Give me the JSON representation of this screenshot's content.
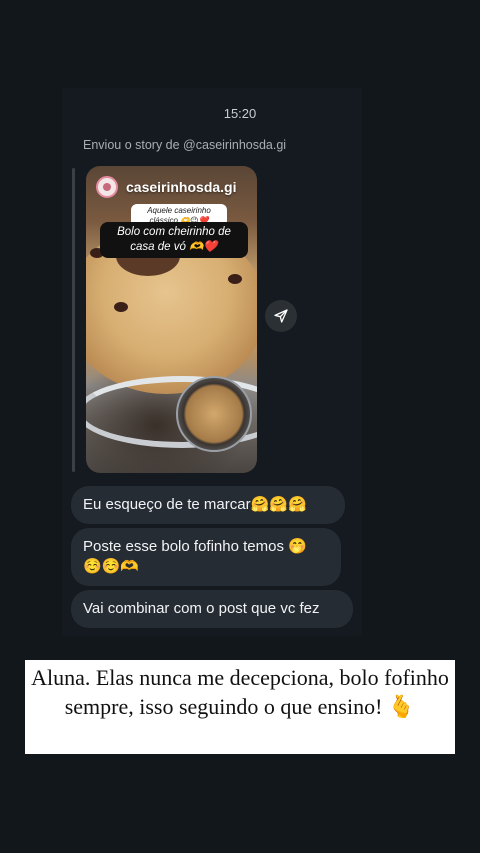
{
  "thread": {
    "timestamp": "15:20",
    "story_reply_caption": "Enviou o story de @caseirinhosda.gi"
  },
  "story": {
    "username": "caseirinhosda.gi",
    "sticker_small": "Aquele caseirinho clássico 🫶😉❤️",
    "sticker_big": "Bolo com cheirinho de casa de vó 🫶❤️",
    "avatar_icon": "profile-avatar-icon",
    "share_icon": "send-paper-plane-icon"
  },
  "messages": [
    {
      "text": "Eu esqueço de te marcar🤗🤗🤗"
    },
    {
      "text": "Poste esse bolo fofinho temos 🤭 ☺️☺️🫶"
    },
    {
      "text": "Vai combinar com o post que vc fez"
    }
  ],
  "overlay": {
    "caption": "Aluna. Elas nunca me decepciona, bolo fofinho sempre, isso seguindo o que ensino! 🫰"
  },
  "colors": {
    "background": "#12171c",
    "bubble": "#262c33",
    "overlay_bg": "#ffffff"
  }
}
